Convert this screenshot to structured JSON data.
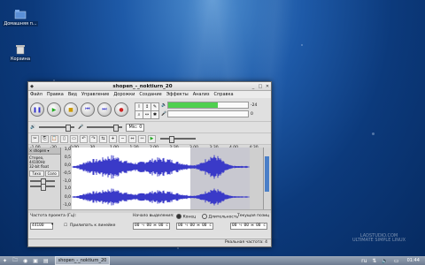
{
  "desktop": {
    "icons": [
      {
        "label": "Домашняя п...",
        "icon": "home-folder-icon"
      },
      {
        "label": "Корзина",
        "icon": "trash-icon"
      }
    ],
    "watermark_line1": "LADSTUDIO.COM",
    "watermark_line2": "ULTIMATE SIMPLE LINUX"
  },
  "window": {
    "title": "shopen_-_noktiurn_20",
    "menu": [
      "Файл",
      "Правка",
      "Вид",
      "Управление",
      "Дорожки",
      "Создание",
      "Эффекты",
      "Анализ",
      "Справка"
    ],
    "meter_scale_l": "-24",
    "meter_scale_r": "0",
    "meter_level": 0.62,
    "mic_dropdown": "Mic: 0",
    "ruler_ticks": [
      "-1,00",
      "-30",
      "0,00",
      "30",
      "1,00",
      "1:30",
      "2,00",
      "2:30",
      "3,00",
      "3:30",
      "4,00",
      "4:30"
    ],
    "track": {
      "name": "shopen",
      "info1": "Стерео, 44100Hz",
      "info2": "32-bit float",
      "mute": "Тихо",
      "solo": "Соло",
      "scale": [
        "1,0",
        "0,5",
        "0,0",
        "-0,5",
        "-1,0",
        "1,0",
        "0,0",
        "-1,0"
      ]
    },
    "bottom": {
      "rate_label": "Частота проекта (Гц):",
      "rate_value": "44100",
      "snap_label": "Прилипать к линейке",
      "sel_start_label": "Начало выделения:",
      "end_label": "Конец",
      "length_label": "Длительность",
      "pos_label": "Текущая позиц",
      "time1": "00 ч 00 м 00 с",
      "time2": "00 ч 00 м 00 с",
      "time3": "00 ч 00 м 00 с"
    },
    "status": "Реальная частота: 4"
  },
  "taskbar": {
    "task_label": "shopen_-_noktiurn_20",
    "lang": "ru",
    "clock": "01:44"
  },
  "colors": {
    "waveform": "#3a3ac8",
    "accent": "#4a7fc8"
  }
}
